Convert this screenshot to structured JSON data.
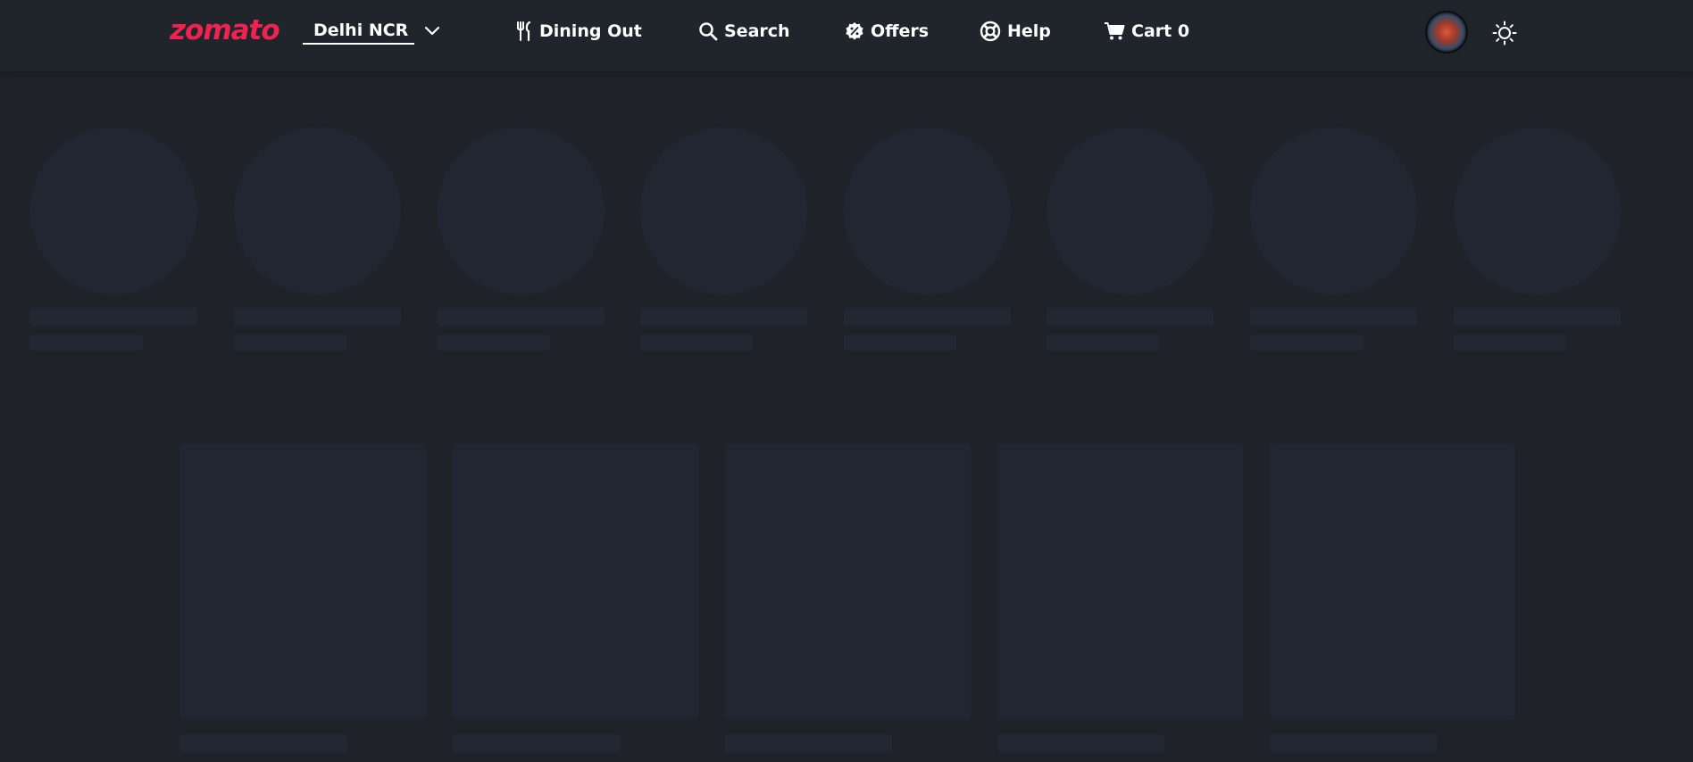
{
  "brand": {
    "name": "zomato",
    "color": "#ef234f"
  },
  "location": {
    "selected": "Delhi NCR",
    "dropdown_icon": "chevron-down-icon"
  },
  "nav": {
    "dining_out": {
      "label": "Dining Out",
      "icon": "fork-knife-icon"
    },
    "search": {
      "label": "Search",
      "icon": "search-icon"
    },
    "offers": {
      "label": "Offers",
      "icon": "offer-badge-icon"
    },
    "help": {
      "label": "Help",
      "icon": "lifebuoy-icon"
    },
    "cart": {
      "label": "Cart 0",
      "icon": "cart-icon"
    }
  },
  "user": {
    "avatar_icon": "avatar"
  },
  "theme": {
    "icon": "sun-icon"
  },
  "loading": {
    "category_placeholders": 8,
    "card_placeholders": 5,
    "skeleton_color": "#212633",
    "background_color": "#1f2329"
  }
}
